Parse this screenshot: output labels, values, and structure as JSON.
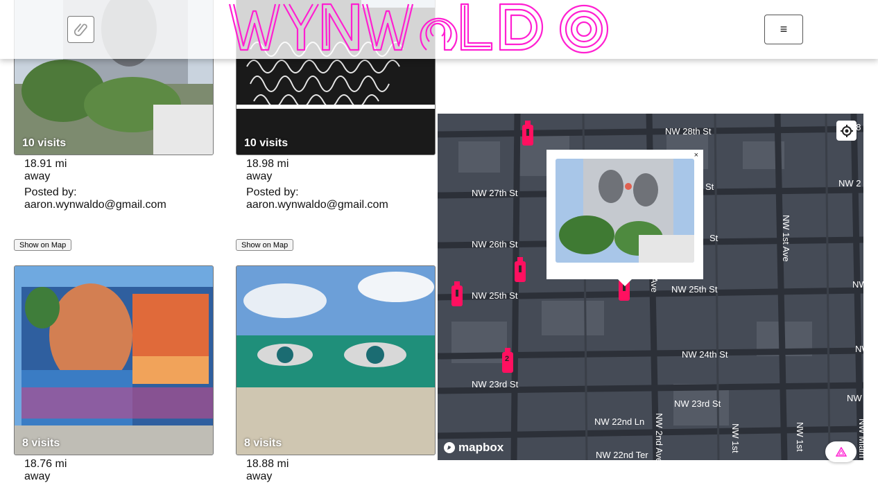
{
  "header": {
    "logo_text": "WYNWALDO",
    "attach_icon": "paperclip-icon",
    "menu_icon": "hamburger-icon",
    "menu_glyph": "≡",
    "brand_color": "#ff1fd1"
  },
  "cards": [
    {
      "visits": "10 visits",
      "distance": "18.91 mi away",
      "posted": "Posted by: aaron.wynwaldo@gmail.com",
      "button": "Show on Map"
    },
    {
      "visits": "10 visits",
      "distance": "18.98 mi away",
      "posted": "Posted by: aaron.wynwaldo@gmail.com",
      "button": "Show on Map"
    },
    {
      "visits": "8 visits",
      "distance": "18.76 mi away"
    },
    {
      "visits": "8 visits",
      "distance": "18.88 mi away"
    }
  ],
  "map": {
    "streets": [
      "NW 28th St",
      "NW 27th St",
      "NW 26th St",
      "NW 25th St",
      "NW 25th St",
      "NW 24th St",
      "NW 23rd St",
      "NW 23rd St",
      "NW 22nd Ln",
      "NW 22nd Ter",
      "NW 1st Ave",
      "NW 2nd Ave"
    ],
    "street_fragments": [
      "St",
      "St",
      "NW 2",
      "NW",
      "NW",
      "NW",
      "NW 1st",
      "NW 1st",
      "NW Miam",
      "Ave",
      "28"
    ],
    "pin_labels": [
      "2"
    ],
    "popup_close": "×",
    "attribution": "mapbox",
    "pin_color": "#ff1060",
    "background": "#454b56"
  }
}
